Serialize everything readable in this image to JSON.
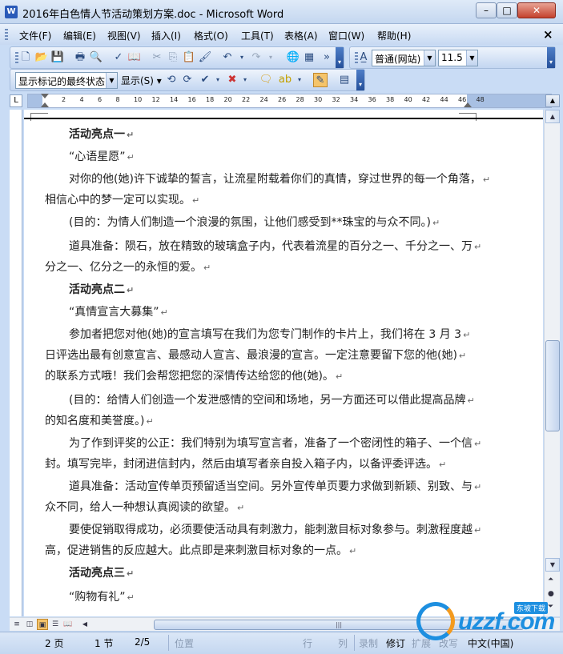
{
  "window": {
    "title": "2016年白色情人节活动策划方案.doc - Microsoft Word",
    "app_icon": "W"
  },
  "menu": [
    "文件(F)",
    "编辑(E)",
    "视图(V)",
    "插入(I)",
    "格式(O)",
    "工具(T)",
    "表格(A)",
    "窗口(W)",
    "帮助(H)"
  ],
  "toolbar": {
    "style_value": "普通(网站)",
    "font_size_value": "11.5",
    "markup_view": "显示标记的最终状态",
    "show_menu": "显示(S)"
  },
  "ruler": {
    "ticks": [
      "2",
      "4",
      "6",
      "8",
      "10",
      "12",
      "14",
      "16",
      "18",
      "20",
      "22",
      "24",
      "26",
      "28",
      "30",
      "32",
      "34",
      "36",
      "38",
      "40",
      "42",
      "44",
      "46",
      "48"
    ],
    "tab_selector": "L"
  },
  "document": {
    "paragraphs": [
      {
        "text": "活动亮点一",
        "bold": true
      },
      {
        "text": "“心语星愿”",
        "bold": false
      },
      {
        "text": "对你的他(她)许下诚挚的誓言，让流星附载着你们的真情，穿过世界的每一个角落，",
        "bold": false
      },
      {
        "text": "相信心中的梦一定可以实现。",
        "bold": false
      },
      {
        "text": "(目的：为情人们制造一个浪漫的氛围，让他们感受到**珠宝的与众不同。)",
        "bold": false
      },
      {
        "text": "道具准备：陨石，放在精致的玻璃盒子内，代表着流星的百分之一、千分之一、万",
        "bold": false
      },
      {
        "text": "分之一、亿分之一的永恒的爱。",
        "bold": false
      },
      {
        "text": "活动亮点二",
        "bold": true
      },
      {
        "text": "“真情宣言大募集”",
        "bold": false
      },
      {
        "text": "参加者把您对他(她)的宣言填写在我们为您专门制作的卡片上，我们将在 3 月 3",
        "bold": false
      },
      {
        "text": "日评选出最有创意宣言、最感动人宣言、最浪漫的宣言。一定注意要留下您的他(她)",
        "bold": false
      },
      {
        "text": "的联系方式哦！我们会帮您把您的深情传达给您的他(她)。",
        "bold": false
      },
      {
        "text": "(目的：给情人们创造一个发泄感情的空间和场地，另一方面还可以借此提高品牌",
        "bold": false
      },
      {
        "text": "的知名度和美誉度。)",
        "bold": false
      },
      {
        "text": "为了作到评奖的公正：我们特别为填写宣言者，准备了一个密闭性的箱子、一个信",
        "bold": false
      },
      {
        "text": "封。填写完毕，封闭进信封内，然后由填写者亲自投入箱子内，以备评委评选。",
        "bold": false
      },
      {
        "text": "道具准备：活动宣传单页预留适当空间。另外宣传单页要力求做到新颖、别致、与",
        "bold": false
      },
      {
        "text": "众不同，给人一种想认真阅读的欲望。",
        "bold": false
      },
      {
        "text": "要使促销取得成功，必须要使活动具有刺激力，能刺激目标对象参与。刺激程度越",
        "bold": false
      },
      {
        "text": "高，促进销售的反应越大。此点即是来刺激目标对象的一点。",
        "bold": false
      },
      {
        "text": "活动亮点三",
        "bold": true
      },
      {
        "text": "“购物有礼”",
        "bold": false
      }
    ],
    "paragraph_mark": "↵"
  },
  "statusbar": {
    "page": "2 页",
    "section": "1 节",
    "pages": "2/5",
    "position": "位置",
    "line": "行",
    "column": "列",
    "record": "录制",
    "revise": "修订",
    "extend": "扩展",
    "overwrite": "改写",
    "language": "中文(中国)"
  },
  "watermark": {
    "text": "uzzf",
    "domain": ".com",
    "badge": "东坡下载"
  },
  "colors": {
    "frame": "#c9dcf5",
    "accent": "#1d8fe0",
    "accent2": "#f39a1e"
  }
}
